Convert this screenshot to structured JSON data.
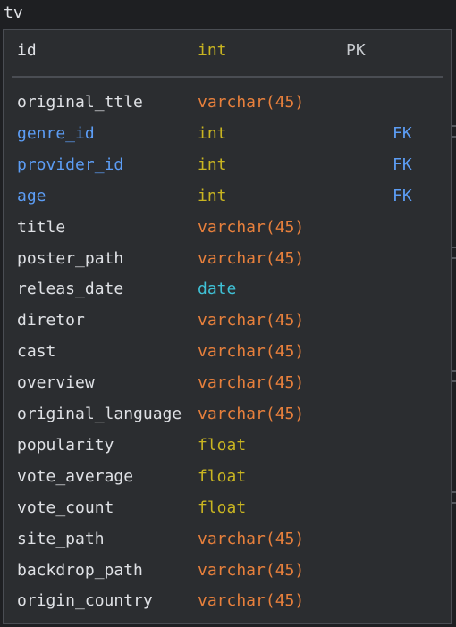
{
  "table": {
    "name": "tv",
    "primary": {
      "name": "id",
      "type": "int",
      "key": "PK"
    },
    "columns": [
      {
        "name": "original_ttle",
        "type": "varchar(45)",
        "key": ""
      },
      {
        "name": "genre_id",
        "type": "int",
        "key": "FK"
      },
      {
        "name": "provider_id",
        "type": "int",
        "key": "FK"
      },
      {
        "name": "age",
        "type": "int",
        "key": "FK"
      },
      {
        "name": "title",
        "type": "varchar(45)",
        "key": ""
      },
      {
        "name": "poster_path",
        "type": "varchar(45)",
        "key": ""
      },
      {
        "name": "releas_date",
        "type": "date",
        "key": ""
      },
      {
        "name": "diretor",
        "type": "varchar(45)",
        "key": ""
      },
      {
        "name": "cast",
        "type": "varchar(45)",
        "key": ""
      },
      {
        "name": "overview",
        "type": "varchar(45)",
        "key": ""
      },
      {
        "name": "original_language",
        "type": "varchar(45)",
        "key": ""
      },
      {
        "name": "popularity",
        "type": "float",
        "key": ""
      },
      {
        "name": "vote_average",
        "type": "float",
        "key": ""
      },
      {
        "name": "vote_count",
        "type": "float",
        "key": ""
      },
      {
        "name": "site_path",
        "type": "varchar(45)",
        "key": ""
      },
      {
        "name": "backdrop_path",
        "type": "varchar(45)",
        "key": ""
      },
      {
        "name": "origin_country",
        "type": "varchar(45)",
        "key": ""
      }
    ]
  },
  "colors": {
    "name_default": "#dfe1e5",
    "name_foreign_key": "#5c9df5",
    "type_varchar": "#e8803c",
    "type_numeric": "#c9b521",
    "type_date": "#3fc1d6",
    "key_primary": "#c5c8cc",
    "key_foreign": "#5c9df5"
  }
}
